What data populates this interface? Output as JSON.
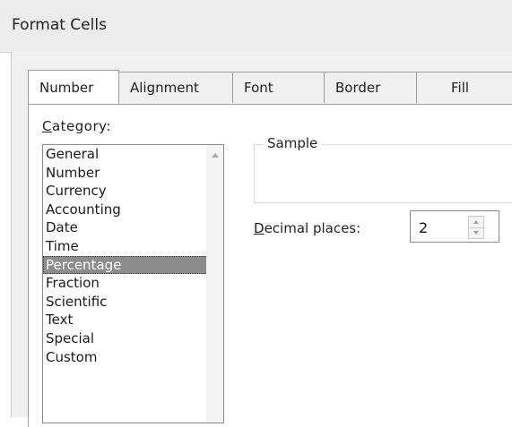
{
  "window": {
    "title": "Format Cells"
  },
  "tabs": [
    {
      "label": "Number",
      "active": true
    },
    {
      "label": "Alignment",
      "active": false
    },
    {
      "label": "Font",
      "active": false
    },
    {
      "label": "Border",
      "active": false
    },
    {
      "label": "Fill",
      "active": false
    }
  ],
  "category": {
    "label_accel": "C",
    "label_rest": "ategory:",
    "items": [
      "General",
      "Number",
      "Currency",
      "Accounting",
      "Date",
      "Time",
      "Percentage",
      "Fraction",
      "Scientific",
      "Text",
      "Special",
      "Custom"
    ],
    "selected": "Percentage",
    "scroll_icon": "scroll-up-arrow-icon"
  },
  "sample": {
    "legend": "Sample",
    "value": ""
  },
  "decimal_places": {
    "label_accel": "D",
    "label_rest": "ecimal places:",
    "value": "2",
    "spinner_icon": "spinner-arrows-icon"
  },
  "colors": {
    "selection_bg": "#8c8c8c",
    "selection_text": "#ffffff",
    "dialog_bg": "#f0f0f0",
    "titlebar_bg": "#ececec"
  }
}
